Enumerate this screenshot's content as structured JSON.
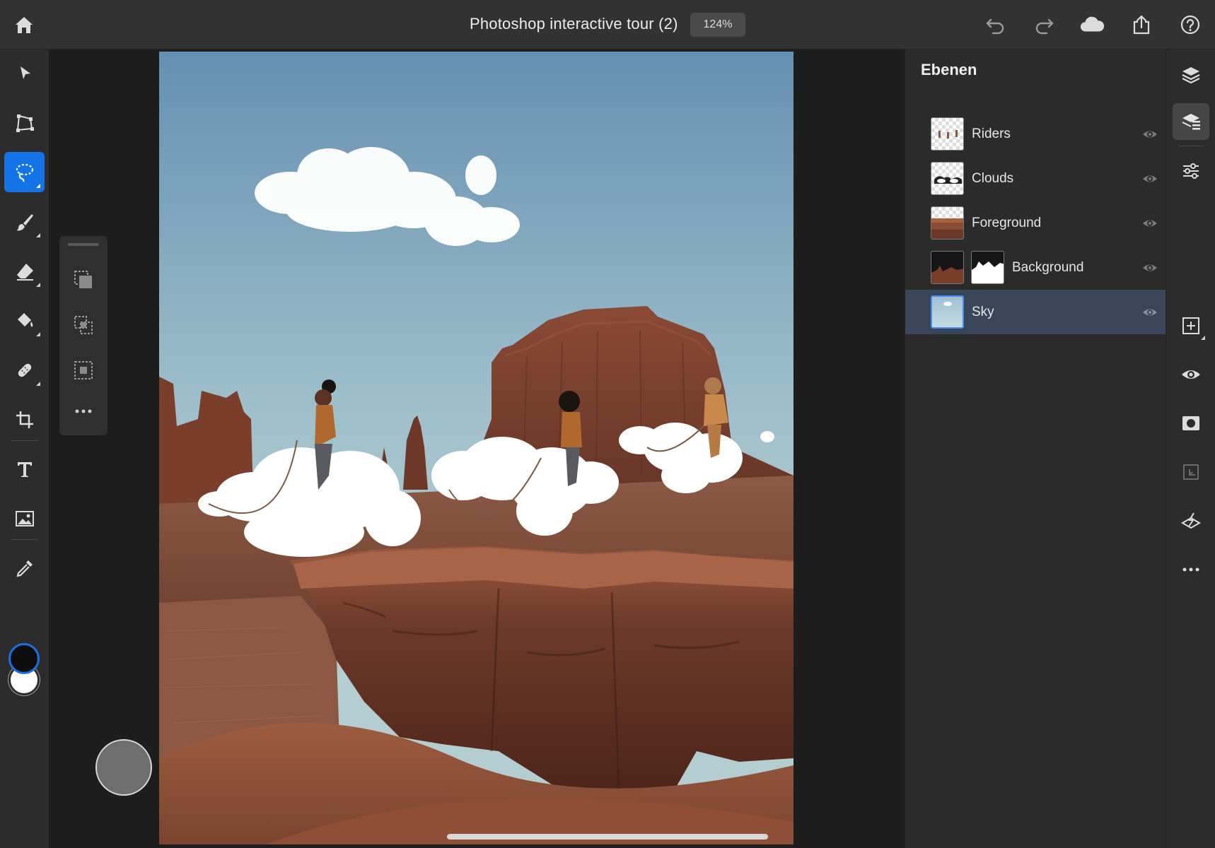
{
  "header": {
    "title": "Photoshop interactive tour (2)",
    "zoom": "124%",
    "icons": [
      "home-icon",
      "undo-icon",
      "redo-icon",
      "cloud-icon",
      "share-icon",
      "help-icon"
    ]
  },
  "tools": {
    "items": [
      "select-arrow",
      "transform",
      "lasso",
      "brush",
      "eraser",
      "paint-bucket",
      "healing",
      "crop",
      "type",
      "place-image",
      "eyedropper"
    ],
    "active": "lasso",
    "foreground_color": "#0d0d0d",
    "background_color": "#ffffff",
    "accent": "#1473e6"
  },
  "subtools": {
    "items": [
      "selection-new",
      "selection-add",
      "selection-subtract",
      "more"
    ]
  },
  "layers": {
    "title": "Ebenen",
    "items": [
      {
        "name": "Riders",
        "visible": true,
        "selected": false
      },
      {
        "name": "Clouds",
        "visible": true,
        "selected": false
      },
      {
        "name": "Foreground",
        "visible": true,
        "selected": false
      },
      {
        "name": "Background",
        "visible": true,
        "selected": false,
        "has_mask": true
      },
      {
        "name": "Sky",
        "visible": true,
        "selected": true
      }
    ]
  },
  "right_panel": {
    "icons": [
      "layers-icon",
      "layer-properties-icon",
      "adjustments-icon",
      "add-layer-icon",
      "visibility-icon",
      "mask-icon",
      "arrange-icon",
      "clip-icon",
      "more-icon"
    ],
    "active": "layer-properties-icon"
  }
}
